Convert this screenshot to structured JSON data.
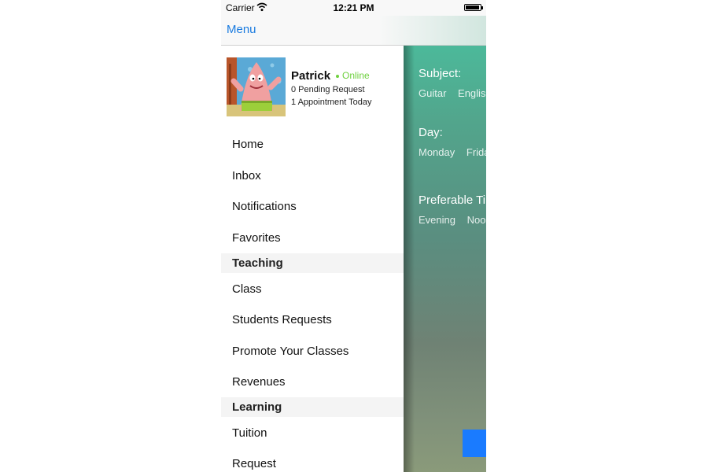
{
  "status_bar": {
    "carrier": "Carrier",
    "time": "12:21 PM",
    "battery_level": 0.95
  },
  "nav": {
    "title": "Menu"
  },
  "profile": {
    "name": "Patrick",
    "status": "Online",
    "pending": "0 Pending Request",
    "appointments": "1 Appointment Today"
  },
  "menu": {
    "items_top": [
      "Home",
      "Inbox",
      "Notifications",
      "Favorites"
    ],
    "section_teaching": "Teaching",
    "items_teaching": [
      "Class",
      "Students Requests",
      "Promote Your Classes",
      "Revenues"
    ],
    "section_learning": "Learning",
    "items_learning": [
      "Tuition",
      "Request"
    ]
  },
  "background": {
    "subject_label": "Subject:",
    "subjects": [
      "Guitar",
      "Englis"
    ],
    "day_label": "Day:",
    "days": [
      "Monday",
      "Frida"
    ],
    "time_label": "Preferable Ti",
    "times": [
      "Evening",
      "Noon"
    ]
  },
  "colors": {
    "accent": "#1a7be0",
    "online": "#6fd13f",
    "section_bg": "#f4f4f4",
    "bg_green": "#4cb99a"
  }
}
